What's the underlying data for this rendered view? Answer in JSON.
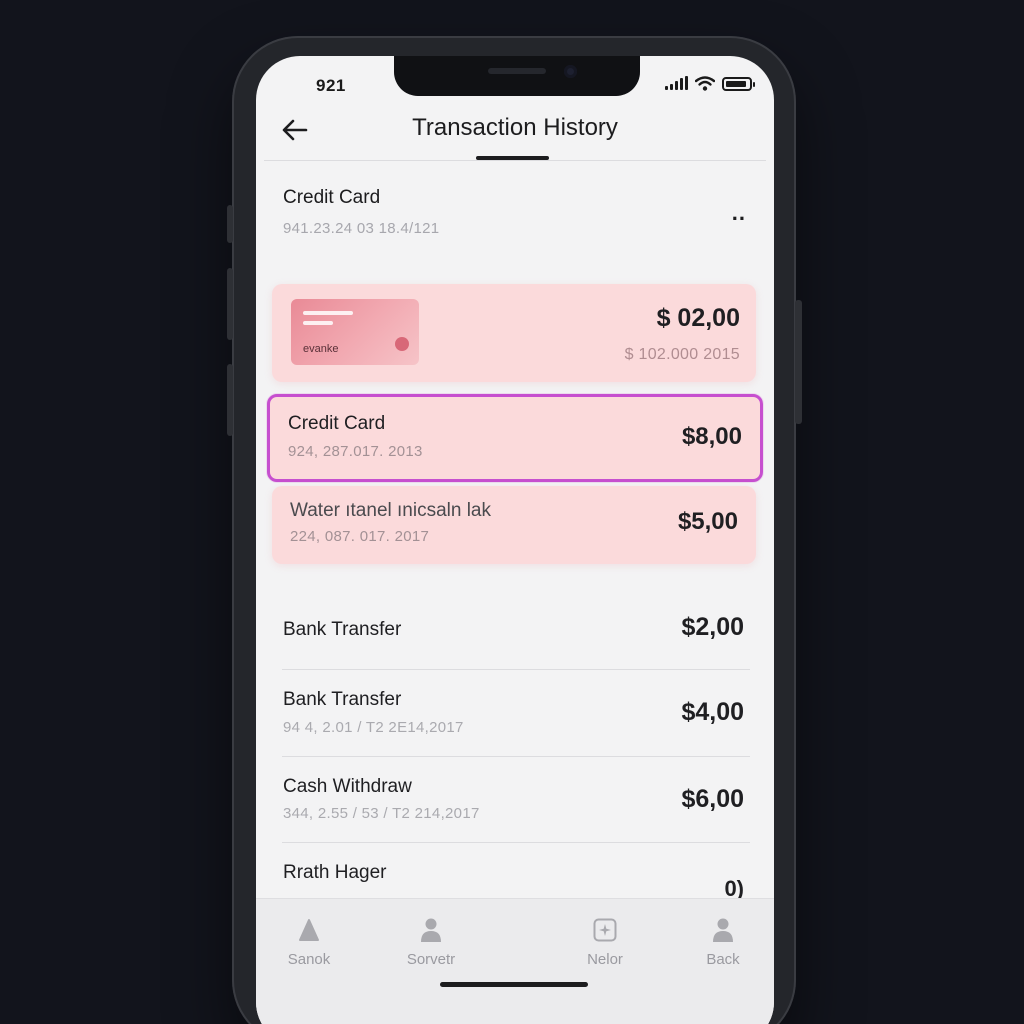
{
  "status_bar": {
    "time": "921"
  },
  "header": {
    "title": "Transaction History"
  },
  "account": {
    "title": "Credit Card",
    "subtitle": "941.23.24 03 18.4/121",
    "more_label": ".."
  },
  "featured_card": {
    "brand": "evanke",
    "amount": "$ 02,00",
    "sub": "$ 102.000 2015"
  },
  "highlighted": [
    {
      "title": "Credit Card",
      "subtitle": "924, 287.017. 2013",
      "amount": "$8,00",
      "selected": true
    },
    {
      "title": "Water ıtanel ınicsaln lak",
      "subtitle": "224, 087. 017. 2017",
      "amount": "$5,00",
      "selected": false
    }
  ],
  "transactions": [
    {
      "title": "Bank Transfer",
      "subtitle": "",
      "amount": "$2,00"
    },
    {
      "title": "Bank Transfer",
      "subtitle": "94 4, 2.01 / T2 2E14,2017",
      "amount": "$4,00"
    },
    {
      "title": "Cash Withdraw",
      "subtitle": "344, 2.55 / 53 / T2 214,2017",
      "amount": "$6,00"
    },
    {
      "title": "Rrath Hager",
      "subtitle": "",
      "amount": "0)"
    }
  ],
  "tabs": [
    {
      "label": "Sanok",
      "icon": "mountain-icon"
    },
    {
      "label": "Sorvetr",
      "icon": "person-icon"
    },
    {
      "label": "Nelor",
      "icon": "sparkle-icon"
    },
    {
      "label": "Back",
      "icon": "person-icon"
    }
  ],
  "colors": {
    "accent": "#c64fcf",
    "card_pink": "#fbdadb",
    "background": "#12141c"
  }
}
